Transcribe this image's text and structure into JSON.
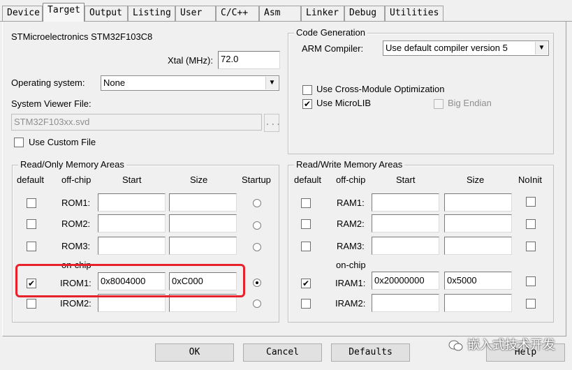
{
  "tabs": [
    "Device",
    "Target",
    "Output",
    "Listing",
    "User",
    "C/C++",
    "Asm",
    "Linker",
    "Debug",
    "Utilities"
  ],
  "active_tab": "Target",
  "device_name": "STMicroelectronics STM32F103C8",
  "xtal": {
    "label": "Xtal (MHz):",
    "value": "72.0"
  },
  "os": {
    "label": "Operating system:",
    "value": "None"
  },
  "system_viewer": {
    "label": "System Viewer File:",
    "value": "STM32F103xx.svd",
    "browse_label": "..."
  },
  "use_custom_file": {
    "label": "Use Custom File",
    "checked": false
  },
  "code_gen": {
    "title": "Code Generation",
    "arm_compiler_label": "ARM Compiler:",
    "arm_compiler_value": "Use default compiler version 5",
    "cross_module": {
      "label": "Use Cross-Module Optimization",
      "checked": false
    },
    "microlib": {
      "label": "Use MicroLIB",
      "checked": true,
      "mark": "✔"
    },
    "big_endian": {
      "label": "Big Endian",
      "checked": false
    }
  },
  "ro_memory": {
    "title": "Read/Only Memory Areas",
    "headers": {
      "default": "default",
      "offchip": "off-chip",
      "start": "Start",
      "size": "Size",
      "startup": "Startup"
    },
    "onchip_label": "on-chip",
    "rows": [
      {
        "name": "ROM1:",
        "start": "",
        "size": "",
        "default": false,
        "startup": false
      },
      {
        "name": "ROM2:",
        "start": "",
        "size": "",
        "default": false,
        "startup": false
      },
      {
        "name": "ROM3:",
        "start": "",
        "size": "",
        "default": false,
        "startup": false
      },
      {
        "name": "IROM1:",
        "start": "0x8004000",
        "size": "0xC000",
        "default": true,
        "startup": true,
        "mark": "✔"
      },
      {
        "name": "IROM2:",
        "start": "",
        "size": "",
        "default": false,
        "startup": false
      }
    ]
  },
  "rw_memory": {
    "title": "Read/Write Memory Areas",
    "headers": {
      "default": "default",
      "offchip": "off-chip",
      "start": "Start",
      "size": "Size",
      "noinit": "NoInit"
    },
    "onchip_label": "on-chip",
    "rows": [
      {
        "name": "RAM1:",
        "start": "",
        "size": "",
        "default": false
      },
      {
        "name": "RAM2:",
        "start": "",
        "size": "",
        "default": false
      },
      {
        "name": "RAM3:",
        "start": "",
        "size": "",
        "default": false
      },
      {
        "name": "IRAM1:",
        "start": "0x20000000",
        "size": "0x5000",
        "default": true,
        "mark": "✔"
      },
      {
        "name": "IRAM2:",
        "start": "",
        "size": "",
        "default": false
      }
    ]
  },
  "buttons": {
    "ok": "OK",
    "cancel": "Cancel",
    "defaults": "Defaults",
    "help": "Help"
  },
  "watermark": "嵌入式技术开发",
  "colors": {
    "highlight": "#e8222a"
  }
}
